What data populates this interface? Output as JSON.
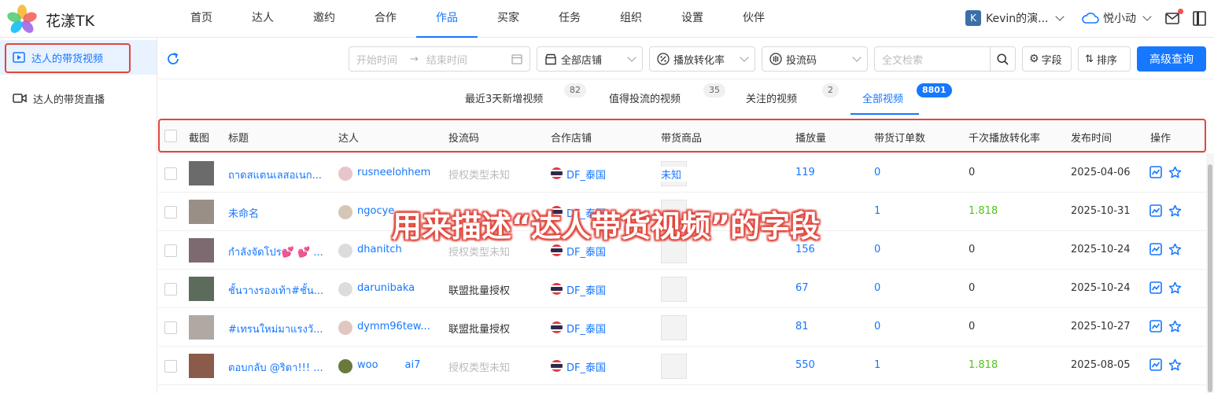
{
  "app": {
    "brand": "花漾TK"
  },
  "nav": [
    "首页",
    "达人",
    "邀约",
    "合作",
    "作品",
    "买家",
    "任务",
    "组织",
    "设置",
    "伙伴"
  ],
  "account": {
    "initial": "K",
    "name": "Kevin的演...",
    "team": "悦小动"
  },
  "sidebar": {
    "items": [
      {
        "label": "达人的带货视频",
        "icon": "play-video-icon"
      },
      {
        "label": "达人的带货直播",
        "icon": "live-camera-icon"
      }
    ]
  },
  "filters": {
    "start_placeholder": "开始时间",
    "end_placeholder": "结束时间",
    "shop": "全部店铺",
    "rate": "播放转化率",
    "code": "投流码",
    "search_placeholder": "全文检索",
    "fields": "字段",
    "sort": "排序",
    "advanced": "高级查询"
  },
  "tabs": [
    {
      "label": "最近3天新增视频",
      "count": "82"
    },
    {
      "label": "值得投流的视频",
      "count": "35"
    },
    {
      "label": "关注的视频",
      "count": "2"
    },
    {
      "label": "全部视频",
      "count": "8801"
    }
  ],
  "columns": [
    "截图",
    "标题",
    "达人",
    "投流码",
    "合作店铺",
    "带货商品",
    "播放量",
    "带货订单数",
    "千次播放转化率",
    "发布时间",
    "操作"
  ],
  "rows": [
    {
      "title": "ถาดสแตนเลสอเนก...",
      "creator": "rusneelohhem",
      "code": "授权类型未知",
      "code_muted": true,
      "shop": "DF_泰国",
      "product": "未知",
      "plays": "119",
      "orders": "0",
      "rate": "0",
      "date": "2025-04-06"
    },
    {
      "title": "未命名",
      "creator": "ngocye",
      "code": "",
      "code_muted": false,
      "shop": "DF_泰国",
      "product": "",
      "plays": "",
      "orders": "1",
      "rate": "1.818",
      "date": "2025-10-31"
    },
    {
      "title": "กำลังจัดโปร💕 💕 ...",
      "creator": "dhanitch",
      "code": "授权类型未知",
      "code_muted": true,
      "shop": "DF_泰国",
      "product": "",
      "plays": "156",
      "orders": "0",
      "rate": "0",
      "date": "2025-10-24"
    },
    {
      "title": "ชั้นวางรองเท้า#ชั้น...",
      "creator": "darunibaka",
      "code": "联盟批量授权",
      "code_muted": false,
      "shop": "DF_泰国",
      "product": "",
      "plays": "67",
      "orders": "0",
      "rate": "0",
      "date": "2025-10-24"
    },
    {
      "title": "#เทรนใหม่มาแรงวั...",
      "creator": "dymm96tew...",
      "code": "联盟批量授权",
      "code_muted": false,
      "shop": "DF_泰国",
      "product": "",
      "plays": "81",
      "orders": "0",
      "rate": "0",
      "date": "2025-10-27"
    },
    {
      "title": "ตอบกลับ @ริดา!!! ...",
      "creator": "woo",
      "creator_tail": "ai7",
      "code": "授权类型未知",
      "code_muted": true,
      "shop": "DF_泰国",
      "product": "",
      "plays": "550",
      "orders": "1",
      "rate": "1.818",
      "date": "2025-08-05"
    }
  ],
  "annotation": "用来描述“达人带货视频”的字段",
  "colors": {
    "accent": "#1677ff",
    "positive": "#52c41a",
    "annotation": "#e0473d"
  }
}
